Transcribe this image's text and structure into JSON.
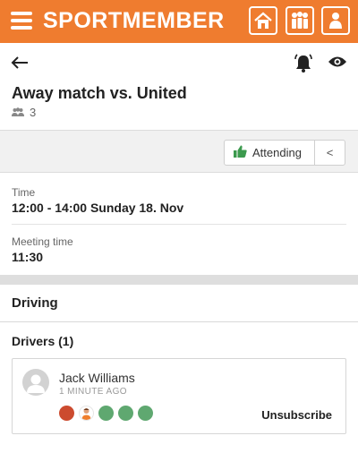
{
  "app": {
    "brand": "SPORTMEMBER",
    "accent": "#ef7c2f"
  },
  "topbar": {
    "menu_icon": "hamburger-icon",
    "icons": [
      "home-icon",
      "team-icon",
      "profile-icon"
    ]
  },
  "event": {
    "title": "Away match vs. United",
    "participants_count": "3",
    "header_icons": [
      "back-arrow-icon",
      "bell-icon",
      "eye-icon"
    ]
  },
  "attendance": {
    "status_label": "Attending",
    "status_icon": "thumbs-up-icon",
    "toggle_symbol": "<"
  },
  "details": {
    "time_label": "Time",
    "time_value": "12:00 - 14:00 Sunday 18. Nov",
    "meeting_label": "Meeting time",
    "meeting_value": "11:30"
  },
  "driving": {
    "section_title": "Driving",
    "drivers_heading": "Drivers (1)",
    "drivers": [
      {
        "name": "Jack Williams",
        "time_ago": "1 MINUTE AGO",
        "seats": [
          {
            "status": "driver",
            "color": "#cc4b2f"
          },
          {
            "status": "passenger",
            "color": "#ffffff"
          },
          {
            "status": "free",
            "color": "#5fa870"
          },
          {
            "status": "free",
            "color": "#5fa870"
          },
          {
            "status": "free",
            "color": "#5fa870"
          }
        ],
        "action_label": "Unsubscribe"
      }
    ]
  }
}
